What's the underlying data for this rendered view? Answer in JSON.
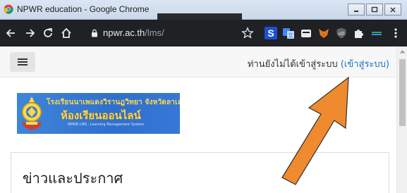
{
  "window": {
    "title": "NPWR education - Google Chrome",
    "controls": [
      "minimize",
      "maximize",
      "close"
    ]
  },
  "toolbar": {
    "url_host": "npwr.ac.th",
    "url_path": "/lms/",
    "extensions": [
      "S-extension-icon",
      "translate-extension-icon",
      "vault-extension-icon",
      "metamask-extension-icon",
      "shield-extension-icon",
      "puzzle-extension-icon",
      "tab-extension-icon"
    ]
  },
  "navbar": {
    "login_status": "ท่านยังไม่ได้เข้าสู่ระบบ",
    "login_link": "(เข้าสู่ระบบ)"
  },
  "news": {
    "title": "ข่าวและประกาศ"
  },
  "annotation": {
    "arrow_color": "#f08a2f",
    "points_to": "login-link"
  },
  "colors": {
    "chrome_dark": "#202124",
    "link": "#1a73c7",
    "logo_blue": "#2f6fcf",
    "logo_text": "#ffd84a"
  }
}
